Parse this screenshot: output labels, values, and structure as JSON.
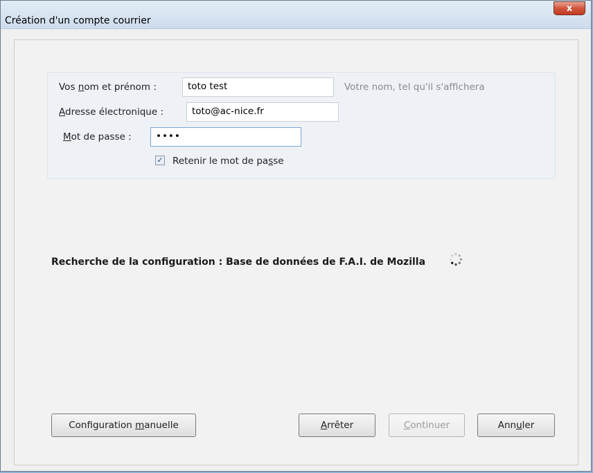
{
  "window": {
    "title": "Création d'un compte courrier",
    "close_glyph": "x"
  },
  "form": {
    "name_label_pre": "Vos ",
    "name_label_u": "n",
    "name_label_post": "om et prénom :",
    "name_value": "toto test",
    "name_hint": "Votre nom, tel qu'il s'affichera",
    "email_label_u": "A",
    "email_label_post": "dresse électronique :",
    "email_value": "toto@ac-nice.fr",
    "password_label_u": "M",
    "password_label_post": "ot de passe :",
    "password_value": "••••",
    "remember_checked": true,
    "remember_label_pre": "Retenir le mot de pa",
    "remember_label_u": "s",
    "remember_label_post": "se"
  },
  "status": {
    "text": "Recherche de la configuration : Base de données de F.A.I. de Mozilla"
  },
  "buttons": {
    "manual_pre": "Configuration ",
    "manual_u": "m",
    "manual_post": "anuelle",
    "stop_u": "A",
    "stop_post": "rrêter",
    "continue_u": "C",
    "continue_post": "ontinuer",
    "cancel_pre": "Ann",
    "cancel_u": "u",
    "cancel_post": "ler"
  },
  "icons": {
    "close": "close-icon",
    "spinner": "spinner-icon",
    "checkbox": "checkmark-icon"
  },
  "colors": {
    "titlebar": "#cddcec",
    "close_button": "#c13a21",
    "dialog_bg": "#f0f0f0",
    "input_focus_border": "#7ba3d3"
  }
}
